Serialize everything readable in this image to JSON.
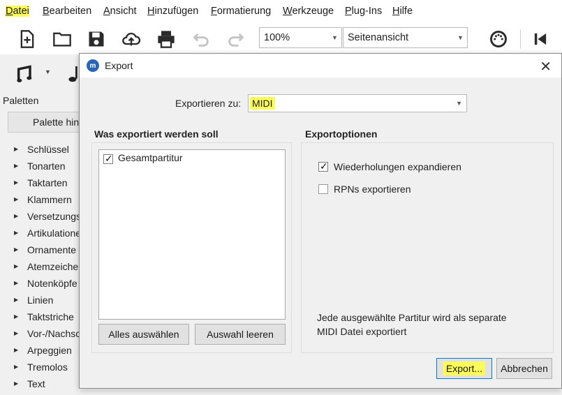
{
  "menu": {
    "items": [
      {
        "first": "D",
        "rest": "atei"
      },
      {
        "first": "B",
        "rest": "earbeiten"
      },
      {
        "first": "A",
        "rest": "nsicht"
      },
      {
        "first": "H",
        "rest": "inzufügen"
      },
      {
        "first": "F",
        "rest": "ormatierung"
      },
      {
        "first": "W",
        "rest": "erkzeuge"
      },
      {
        "first": "P",
        "rest": "lug-Ins"
      },
      {
        "first": "H",
        "rest": "ilfe"
      }
    ]
  },
  "toolbar": {
    "zoom_value": "100%",
    "view_value": "Seitenansicht",
    "icons": [
      "new-file-icon",
      "open-folder-icon",
      "save-icon",
      "cloud-upload-icon",
      "print-icon",
      "undo-icon",
      "redo-icon",
      "midi-input-icon",
      "rewind-icon"
    ]
  },
  "palettes": {
    "title": "Paletten",
    "button_label": "Palette hinzufügen",
    "items": [
      "Schlüssel",
      "Tonarten",
      "Taktarten",
      "Klammern",
      "Versetzungszeichen",
      "Artikulationen",
      "Ornamente",
      "Atemzeichen",
      "Notenköpfe",
      "Linien",
      "Taktstriche",
      "Vor-/Nachschläge",
      "Arpeggien",
      "Tremolos",
      "Text"
    ]
  },
  "dialog": {
    "title": "Export",
    "export_to_label": "Exportieren zu:",
    "export_to_value": "MIDI",
    "what_title": "Was exportiert werden soll",
    "score_items": [
      {
        "label": "Gesamtpartitur",
        "checked": true
      }
    ],
    "select_all": "Alles auswählen",
    "clear_selection": "Auswahl leeren",
    "options_title": "Exportoptionen",
    "options": [
      {
        "label": "Wiederholungen expandieren",
        "checked": true
      },
      {
        "label": "RPNs exportieren",
        "checked": false
      }
    ],
    "note_line1": "Jede ausgewählte Partitur wird als separate",
    "note_line2": "MIDI Datei exportiert",
    "export_button": "Export...",
    "cancel_button": "Abbrechen"
  },
  "colors": {
    "highlight": "#fbfb5a",
    "accent": "#0078d7"
  }
}
